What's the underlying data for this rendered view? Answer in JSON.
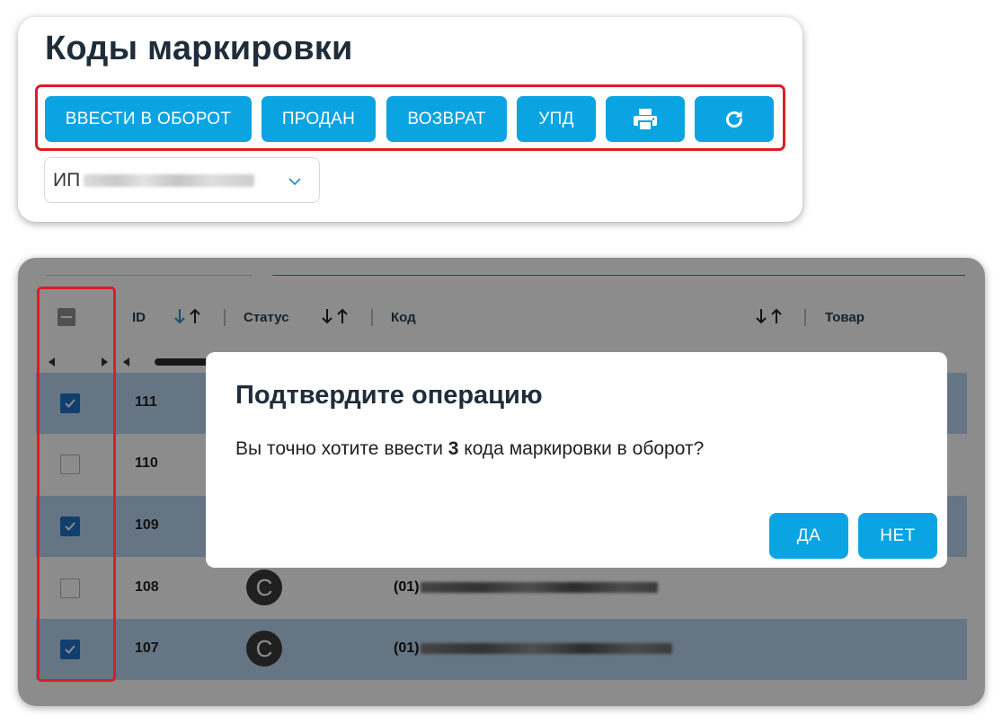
{
  "page": {
    "title": "Коды маркировки"
  },
  "toolbar": {
    "enter_circulation_label": "ВВЕСТИ В ОБОРОТ",
    "sold_label": "ПРОДАН",
    "return_label": "ВОЗВРАТ",
    "upd_label": "УПД",
    "print_icon": "printer-icon",
    "refresh_icon": "refresh-icon",
    "button_color": "#0AA4E3"
  },
  "org_select": {
    "prefix": "ИП",
    "value_redacted": true
  },
  "table": {
    "columns": [
      {
        "key": "id",
        "label": "ID"
      },
      {
        "key": "status",
        "label": "Статус"
      },
      {
        "key": "code",
        "label": "Код"
      },
      {
        "key": "product",
        "label": "Товар"
      }
    ],
    "rows": [
      {
        "id": "111",
        "checked": true,
        "code_prefix": "",
        "status": ""
      },
      {
        "id": "110",
        "checked": false,
        "code_prefix": "",
        "status": ""
      },
      {
        "id": "109",
        "checked": true,
        "code_prefix": "",
        "status": ""
      },
      {
        "id": "108",
        "checked": false,
        "code_prefix": "(01)",
        "status": "C"
      },
      {
        "id": "107",
        "checked": true,
        "code_prefix": "(01)",
        "status": "C"
      }
    ],
    "selected_row_color": "#1E73C9"
  },
  "dialog": {
    "title": "Подтвердите операцию",
    "message_before": "Вы точно хотите ввести ",
    "count": "3",
    "message_after": " кода маркировки в оборот?",
    "yes_label": "ДА",
    "no_label": "НЕТ"
  },
  "highlight_color": "#E01B24"
}
